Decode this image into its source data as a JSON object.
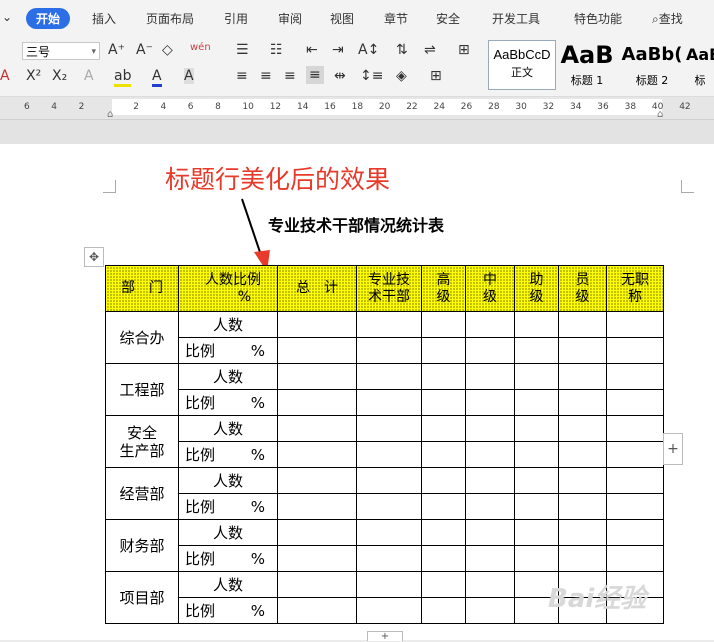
{
  "menu": {
    "collapse_glyph": "⌄",
    "items": [
      "开始",
      "插入",
      "页面布局",
      "引用",
      "审阅",
      "视图",
      "章节",
      "安全",
      "开发工具",
      "特色功能"
    ],
    "search_label": "查找"
  },
  "toolbar": {
    "font_size": "三号",
    "style_gallery": [
      {
        "sample": "AaBbCcD",
        "name": "正文"
      },
      {
        "sample": "AaB",
        "name": "标题 1"
      },
      {
        "sample": "AaBb(",
        "name": "标题 2"
      },
      {
        "sample": "AaB",
        "name": "标"
      }
    ],
    "icons": [
      "A+",
      "A−",
      "◇",
      "wén",
      "A",
      "X²",
      "X₂",
      "A",
      "ab",
      "A",
      "A"
    ]
  },
  "ruler": {
    "numbers": [
      "6",
      "4",
      "2",
      "",
      "2",
      "4",
      "6",
      "8",
      "10",
      "12",
      "14",
      "16",
      "18",
      "20",
      "22",
      "24",
      "26",
      "28",
      "30",
      "32",
      "34",
      "36",
      "38",
      "40",
      "42"
    ]
  },
  "annotation": "标题行美化后的效果",
  "document": {
    "title": "专业技术干部情况统计表",
    "header": {
      "dept": "部　门",
      "ratio_top": "人数比例",
      "ratio_bottom": "%",
      "total": "总　计",
      "prof_tech": [
        "专业技",
        "术干部"
      ],
      "senior": [
        "高",
        "级"
      ],
      "middle": [
        "中",
        "级"
      ],
      "assistant": [
        "助",
        "级"
      ],
      "clerk": [
        "员",
        "级"
      ],
      "no_title": [
        "无职",
        "称"
      ]
    },
    "row_labels": {
      "count": "人数",
      "ratio": "比例",
      "pct": "%"
    },
    "departments": [
      {
        "name": [
          "综合办"
        ]
      },
      {
        "name": [
          "工程部"
        ]
      },
      {
        "name": [
          "安全",
          "生产部"
        ]
      },
      {
        "name": [
          "经营部"
        ]
      },
      {
        "name": [
          "财务部"
        ]
      },
      {
        "name": [
          "项目部"
        ]
      }
    ]
  },
  "watermark": "Bai经验"
}
